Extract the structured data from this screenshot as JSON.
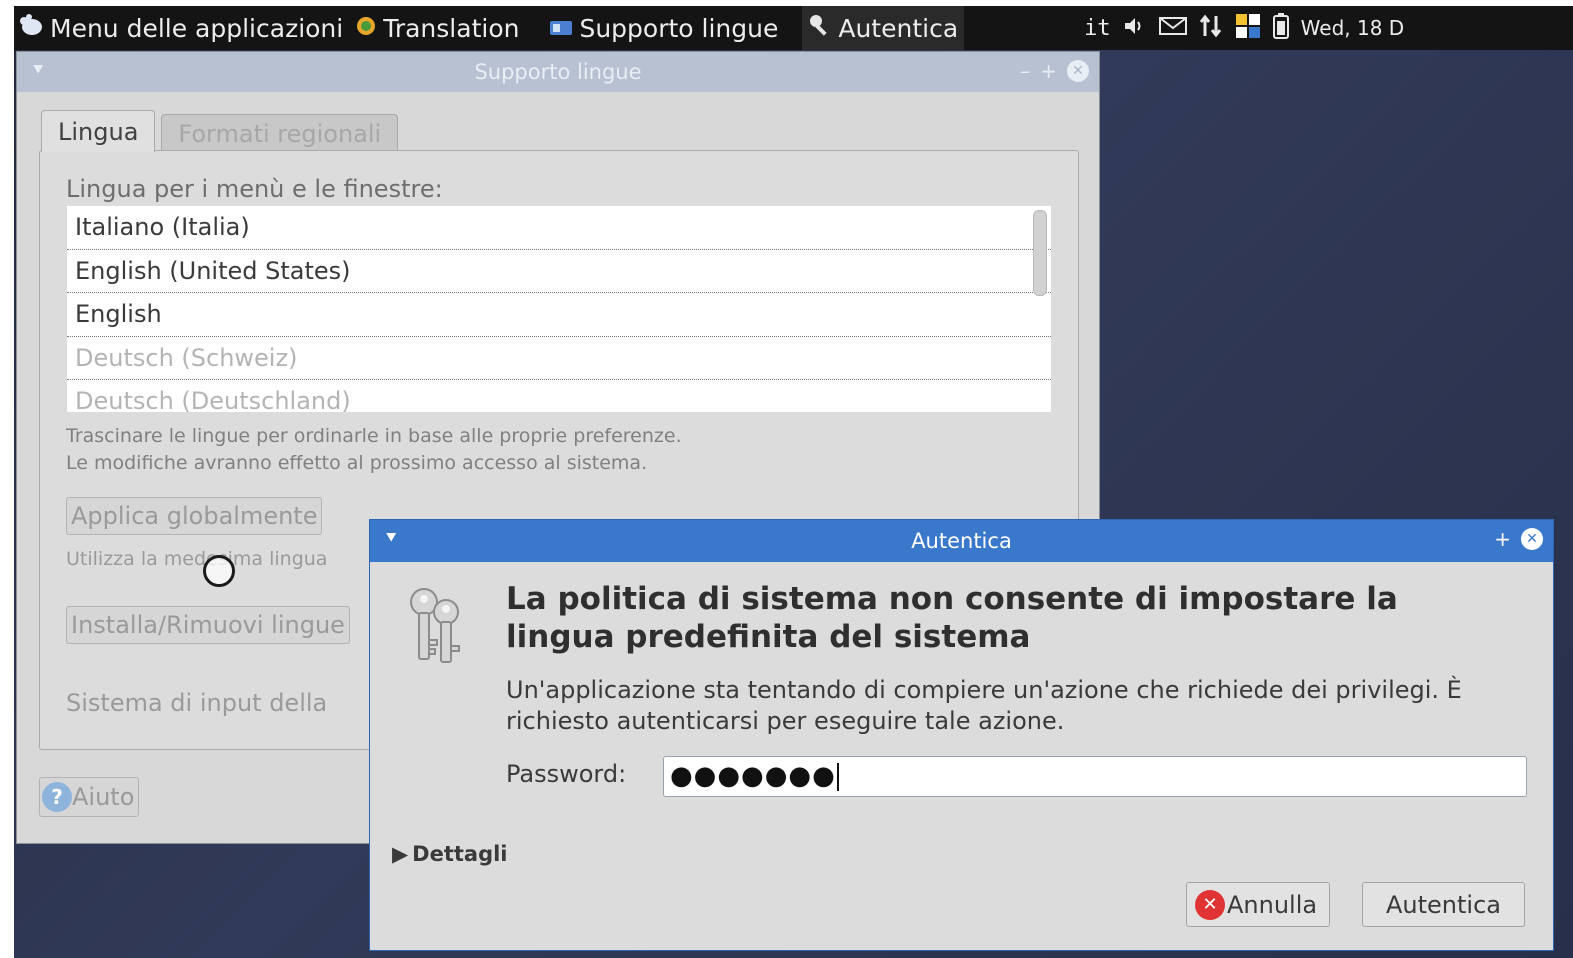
{
  "panel": {
    "app_menu": "Menu delle applicazioni",
    "tasks": [
      "Translation",
      "Supporto lingue",
      "Autentica"
    ],
    "keyboard_layout": "it",
    "clock": "Wed, 18 D"
  },
  "main_window": {
    "title": "Supporto lingue",
    "tabs": [
      "Lingua",
      "Formati regionali"
    ],
    "lang_label": "Lingua per i menù e le finestre:",
    "languages": [
      {
        "name": "Italiano (Italia)",
        "enabled": true
      },
      {
        "name": "English (United States)",
        "enabled": true
      },
      {
        "name": "English",
        "enabled": true
      },
      {
        "name": "Deutsch (Schweiz)",
        "enabled": false
      },
      {
        "name": "Deutsch (Deutschland)",
        "enabled": false
      }
    ],
    "hint_line1": "Trascinare le lingue per ordinarle in base alle proprie preferenze.",
    "hint_line2": "Le modifiche avranno effetto al prossimo accesso al sistema.",
    "apply_button": "Applica globalmente",
    "apply_note": "Utilizza la medesima lingua",
    "install_button": "Installa/Rimuovi lingue",
    "input_system_label": "Sistema di input della",
    "help_button": "Aiuto"
  },
  "auth_dialog": {
    "title": "Autentica",
    "heading": "La politica di sistema non consente di impostare la lingua predefinita del sistema",
    "message": "Un'applicazione sta tentando di compiere un'azione che richiede dei privilegi. È richiesto autenticarsi per eseguire tale azione.",
    "password_label": "Password:",
    "password_masked": "●●●●●●●",
    "details_label": "Dettagli",
    "cancel_button": "Annulla",
    "ok_button": "Autentica"
  },
  "colors": {
    "panel_bg": "#141414",
    "dialog_titlebar": "#3a78cc",
    "inactive_titlebar": "#b7c1d2"
  }
}
